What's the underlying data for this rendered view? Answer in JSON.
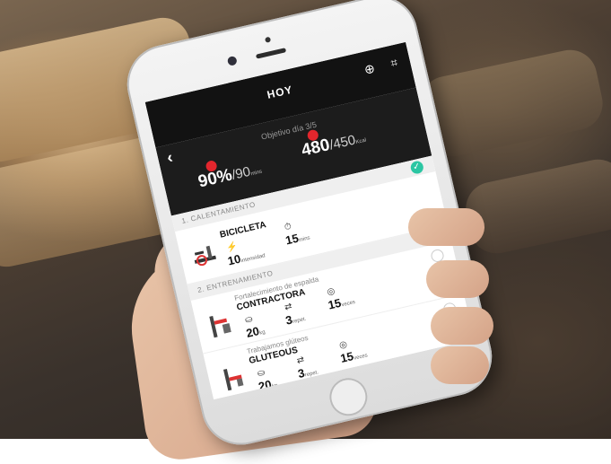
{
  "app": {
    "title": "HOY",
    "objective": "Objetivo día 3/5",
    "icons": [
      "back-icon",
      "add-icon",
      "scan-icon"
    ]
  },
  "summary": {
    "time": {
      "value": "90%",
      "goal": "90",
      "unit": "mins"
    },
    "calories": {
      "value": "480",
      "goal": "450",
      "unit": "Kcal"
    }
  },
  "sections": [
    {
      "label": "1. CALENTAMIENTO",
      "done": true,
      "exercises": [
        {
          "subtitle": "",
          "name": "BICICLETA",
          "metrics": [
            {
              "value": "10",
              "unit": "intensidad",
              "icon": "intensity-icon"
            },
            {
              "value": "15",
              "unit": "mins",
              "icon": "stopwatch-icon"
            }
          ]
        }
      ]
    },
    {
      "label": "2. ENTRENAMIENTO",
      "done": false,
      "exercises": [
        {
          "subtitle": "Fortalecimiento de espalda",
          "name": "CONTRACTORA",
          "metrics": [
            {
              "value": "20",
              "unit": "kg",
              "icon": "weight-icon"
            },
            {
              "value": "3",
              "unit": "repet.",
              "icon": "repeat-icon"
            },
            {
              "value": "15",
              "unit": "veces",
              "icon": "count-icon"
            }
          ]
        },
        {
          "subtitle": "Trabajamos glúteos",
          "name": "GLUTEOUS",
          "metrics": [
            {
              "value": "20",
              "unit": "kg",
              "icon": "weight-icon"
            },
            {
              "value": "3",
              "unit": "repet.",
              "icon": "repeat-icon"
            },
            {
              "value": "15",
              "unit": "veces",
              "icon": "count-icon"
            }
          ]
        }
      ]
    }
  ],
  "colors": {
    "accent_red": "#e3262d",
    "check_green": "#2cc6a3",
    "header_dark": "#121212"
  }
}
